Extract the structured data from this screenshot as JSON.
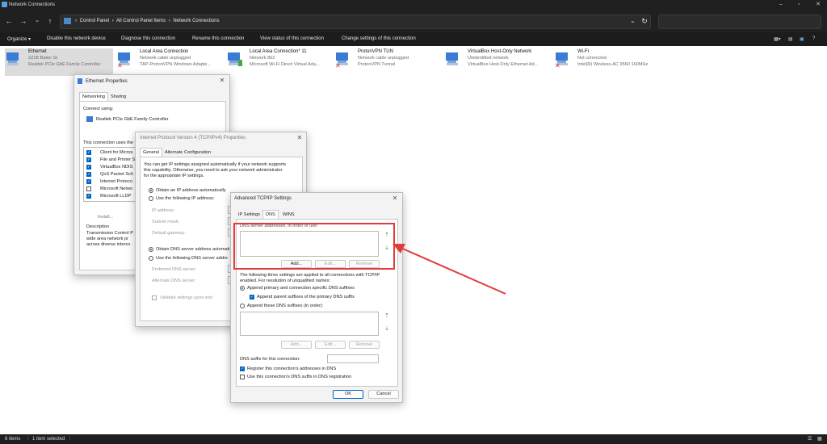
{
  "window": {
    "title": "Network Connections"
  },
  "address": {
    "crumbs": [
      "Control Panel",
      "All Control Panel Items",
      "Network Connections"
    ]
  },
  "command_bar": {
    "organize": "Organize ▾",
    "disable": "Disable this network device",
    "diagnose": "Diagnose this connection",
    "rename": "Rename this connection",
    "view_status": "View status of this connection",
    "change_settings": "Change settings of this connection"
  },
  "adapters": [
    {
      "name": "Ethernet",
      "status": "221B Baker St",
      "device": "Realtek PCIe GbE Family Controller"
    },
    {
      "name": "Local Area Connection",
      "status": "Network cable unplugged",
      "device": "TAP-ProtonVPN Windows Adapte..."
    },
    {
      "name": "Local Area Connection* 11",
      "status": "Network 862",
      "device": "Microsoft Wi-Fi Direct Virtual Ada..."
    },
    {
      "name": "ProtonVPN TUN",
      "status": "Network cable unplugged",
      "device": "ProtonVPN Tunnel"
    },
    {
      "name": "VirtualBox Host-Only Network",
      "status": "Unidentified network",
      "device": "VirtualBox Host-Only Ethernet Ad..."
    },
    {
      "name": "Wi-Fi",
      "status": "Not connected",
      "device": "Intel(R) Wireless-AC 9560 160MHz"
    }
  ],
  "status_bar": {
    "items": "6 items",
    "selected": "1 item selected"
  },
  "eth_props": {
    "title": "Ethernet Properties",
    "tabs": [
      "Networking",
      "Sharing"
    ],
    "connect_using": "Connect using:",
    "adapter": "Realtek PCIe GbE Family Controller",
    "uses": "This connection uses the",
    "items": [
      "Client for Micros",
      "File and Printer S",
      "VirtualBox NDIS",
      "QoS Packet Sch",
      "Internet Protoco",
      "Microsoft Netwo",
      "Microsoft LLDP"
    ],
    "install": "Install...",
    "description": "Description",
    "desc_lines": [
      "Transmission Control P",
      "wide area network pr",
      "across diverse interco"
    ]
  },
  "ipv4": {
    "title": "Internet Protocol Version 4 (TCP/IPv4) Properties",
    "tabs": [
      "General",
      "Alternate Configuration"
    ],
    "intro": [
      "You can get IP settings assigned automatically if your network supports",
      "this capability. Otherwise, you need to ask your network administrator",
      "for the appropriate IP settings."
    ],
    "obtain_ip": "Obtain an IP address automatically",
    "use_ip": "Use the following IP address:",
    "ip_address": "IP address:",
    "subnet": "Subnet mask:",
    "gateway": "Default gateway:",
    "obtain_dns": "Obtain DNS server address automati",
    "use_dns": "Use the following DNS server addre",
    "preferred": "Preferred DNS server:",
    "alternate": "Alternate DNS server:",
    "validate": "Validate settings upon exit"
  },
  "adv": {
    "title": "Advanced TCP/IP Settings",
    "tabs": [
      "IP Settings",
      "DNS",
      "WINS"
    ],
    "dns_list_label": "DNS server addresses, in order of use:",
    "add": "Add...",
    "edit": "Edit...",
    "remove": "Remove",
    "info": [
      "The following three settings are applied to all connections with TCP/IP",
      "enabled. For resolution of unqualified names:"
    ],
    "append_primary": "Append primary and connection specific DNS suffixes",
    "append_parent": "Append parent suffixes of the primary DNS suffix",
    "append_these": "Append these DNS suffixes (in order):",
    "add2": "Add...",
    "edit2": "Edit...",
    "remove2": "Remove",
    "suffix_label": "DNS suffix for this connection:",
    "register": "Register this connection's addresses in DNS",
    "use_suffix": "Use this connection's DNS suffix in DNS registration",
    "ok": "OK",
    "cancel": "Cancel"
  },
  "colors": {
    "highlight_box": "#e23b3b",
    "accent": "#0067c0",
    "chrome": "#1f1f1f"
  }
}
